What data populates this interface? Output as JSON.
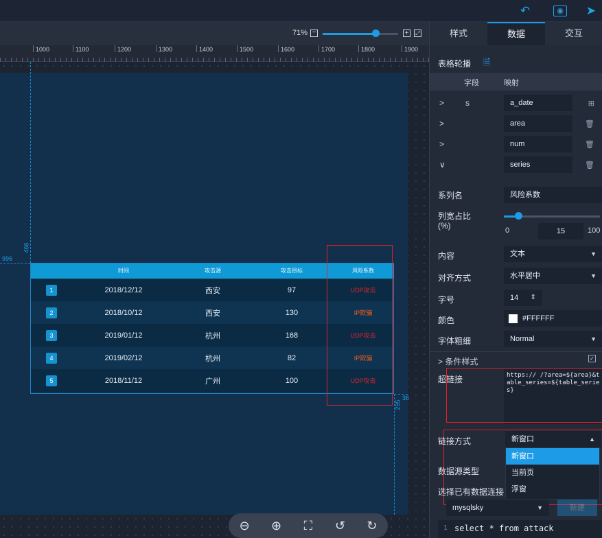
{
  "zoom": {
    "percent": "71%",
    "level": 0.7
  },
  "ruler": {
    "ticks": [
      "1000",
      "1100",
      "1200",
      "1300",
      "1400",
      "1500",
      "1600",
      "1700",
      "1800",
      "1900"
    ]
  },
  "guides": {
    "left_pos": "996",
    "left_top": "466",
    "right_pos": "295",
    "right_top": "36"
  },
  "table": {
    "headers": [
      "时间",
      "攻击源",
      "攻击目标",
      "风险系数"
    ],
    "rows": [
      {
        "rank": "1",
        "time": "2018/12/12",
        "source": "西安",
        "target": "97",
        "risk": "UDP攻击",
        "risk_color": "#e0202a"
      },
      {
        "rank": "2",
        "time": "2018/10/12",
        "source": "西安",
        "target": "130",
        "risk": "IP欺骗",
        "risk_color": "#f05a1a"
      },
      {
        "rank": "3",
        "time": "2019/01/12",
        "source": "杭州",
        "target": "168",
        "risk": "UDP攻击",
        "risk_color": "#e0202a"
      },
      {
        "rank": "4",
        "time": "2019/02/12",
        "source": "杭州",
        "target": "82",
        "risk": "IP欺骗",
        "risk_color": "#f05a1a"
      },
      {
        "rank": "5",
        "time": "2018/11/12",
        "source": "广州",
        "target": "100",
        "risk": "UDP攻击",
        "risk_color": "#e0202a"
      }
    ]
  },
  "panel": {
    "tabs": [
      "样式",
      "数据",
      "交互"
    ],
    "active_tab": "数据",
    "section_title": "表格轮播",
    "mapping_header": {
      "field": "字段",
      "map": "映射"
    },
    "fields": [
      {
        "arrow": ">",
        "name": "s",
        "map": "a_date",
        "action": "⊞"
      },
      {
        "arrow": ">",
        "name": "",
        "map": "area",
        "action": "🗑"
      },
      {
        "arrow": ">",
        "name": "",
        "map": "num",
        "action": "🗑"
      },
      {
        "arrow": "∨",
        "name": "",
        "map": "series",
        "action": "🗑"
      }
    ],
    "series_name_label": "系列名",
    "series_name_value": "风险系数",
    "col_width_label_1": "列宽占比",
    "col_width_label_2": "(%)",
    "col_width_min": "0",
    "col_width_value": "15",
    "col_width_max": "100",
    "content_label": "内容",
    "content_value": "文本",
    "align_label": "对齐方式",
    "align_value": "水平居中",
    "fontsize_label": "字号",
    "fontsize_value": "14",
    "color_label": "颜色",
    "color_value": "#FFFFFF",
    "fontweight_label": "字体粗细",
    "fontweight_value": "Normal",
    "cond_style_label": "> 条件样式",
    "hyperlink_label": "超链接",
    "hyperlink_value": "https://                /?area=${area}&table_series=${table_series}",
    "link_mode_label": "链接方式",
    "link_mode_value": "新窗口",
    "link_mode_options": [
      "新窗口",
      "当前页",
      "浮窗"
    ],
    "datasource_type_label": "数据源类型",
    "select_conn_label": "选择已有数据连接",
    "connection_value": "mysqlsky",
    "new_button": "新建",
    "sql_line_no": "1",
    "sql_text": "select * from attack"
  }
}
